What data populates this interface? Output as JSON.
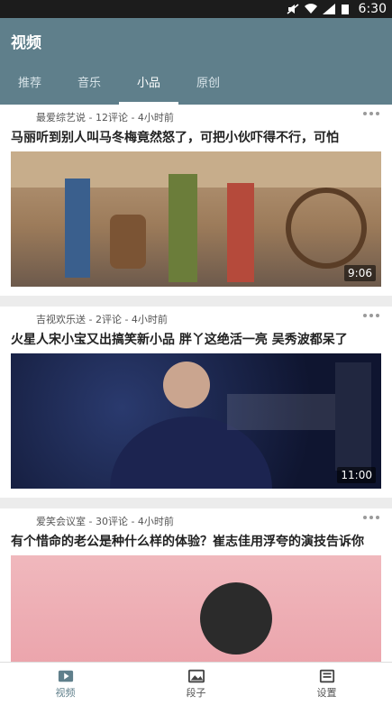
{
  "status": {
    "time": "6:30"
  },
  "app": {
    "title": "视频"
  },
  "tabs": [
    {
      "label": "推荐"
    },
    {
      "label": "音乐"
    },
    {
      "label": "小品"
    },
    {
      "label": "原创"
    }
  ],
  "active_tab_index": 2,
  "feed": [
    {
      "meta": "最爱综艺说 - 12评论 - 4小时前",
      "title": "马丽听到别人叫马冬梅竟然怒了，可把小伙吓得不行，可怕",
      "duration": "9:06"
    },
    {
      "meta": "吉视欢乐送 - 2评论 - 4小时前",
      "title": "火星人宋小宝又出搞笑新小品 胖丫这绝活一亮 吴秀波都呆了",
      "duration": "11:00"
    },
    {
      "meta": "爱笑会议室 - 30评论 - 4小时前",
      "title": "有个惜命的老公是种什么样的体验？崔志佳用浮夸的演技告诉你",
      "duration": ""
    }
  ],
  "bottom_nav": [
    {
      "label": "视频",
      "icon": "video-icon"
    },
    {
      "label": "段子",
      "icon": "image-icon"
    },
    {
      "label": "设置",
      "icon": "settings-icon"
    }
  ],
  "colors": {
    "appbar": "#5f7f8b",
    "accent": "#5f7f8b"
  }
}
